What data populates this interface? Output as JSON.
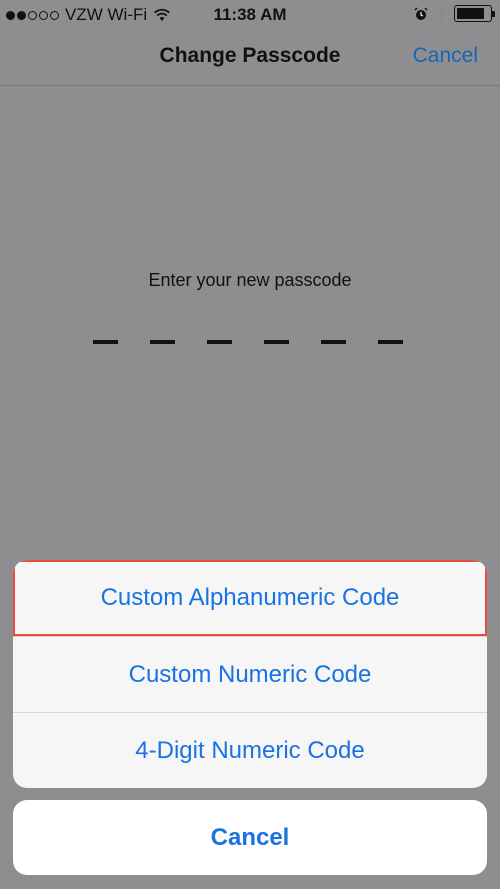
{
  "status_bar": {
    "carrier": "VZW Wi-Fi",
    "time": "11:38 AM",
    "signal_strength_filled": 2,
    "signal_strength_total": 5,
    "icons": [
      "wifi-icon",
      "alarm-icon",
      "bluetooth-icon",
      "battery-icon"
    ]
  },
  "navbar": {
    "title": "Change Passcode",
    "cancel_label": "Cancel"
  },
  "passcode": {
    "prompt": "Enter your new passcode",
    "digit_count": 6
  },
  "action_sheet": {
    "options": [
      {
        "label": "Custom Alphanumeric Code"
      },
      {
        "label": "Custom Numeric Code"
      },
      {
        "label": "4-Digit Numeric Code"
      }
    ],
    "cancel_label": "Cancel"
  },
  "colors": {
    "accent": "#1a73e0",
    "dim_background": "#8e8e90",
    "highlight": "#e74c3c"
  }
}
